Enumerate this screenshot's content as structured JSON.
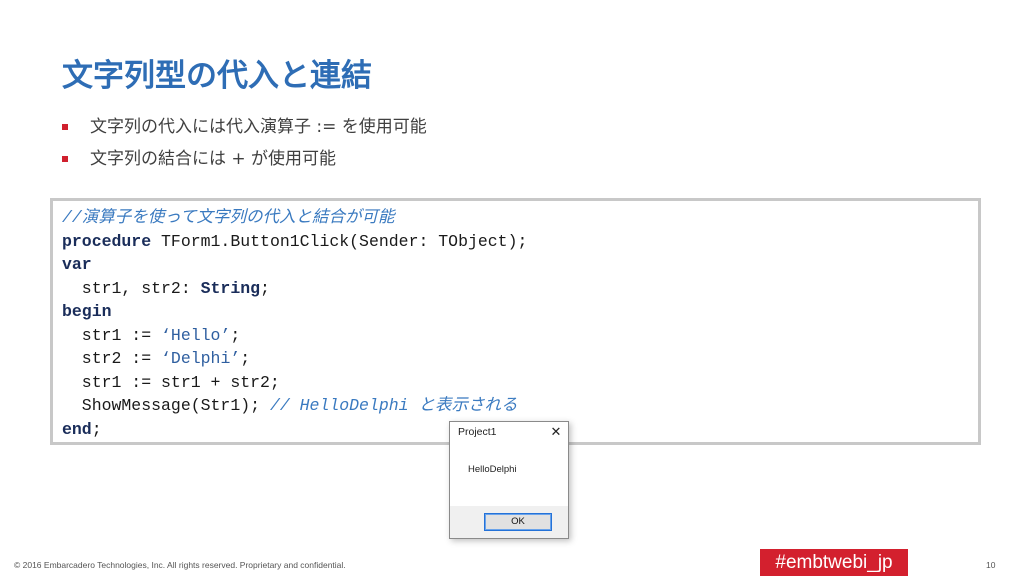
{
  "slide": {
    "title": "文字列型の代入と連結",
    "bullets": [
      "文字列の代入には代入演算子 := を使用可能",
      "文字列の結合には + が使用可能"
    ],
    "accent_color": "#2e6db5",
    "bullet_color": "#d0202e"
  },
  "code": {
    "lines": [
      [
        {
          "t": "//演算子を使って文字列の代入と結合が可能",
          "c": "cm"
        }
      ],
      [
        {
          "t": "procedure",
          "c": "kw"
        },
        {
          "t": " TForm1.Button1Click(Sender: TObject);",
          "c": ""
        }
      ],
      [
        {
          "t": "var",
          "c": "kw"
        }
      ],
      [
        {
          "t": "  str1, str2: ",
          "c": ""
        },
        {
          "t": "String",
          "c": "kw"
        },
        {
          "t": ";",
          "c": ""
        }
      ],
      [
        {
          "t": "begin",
          "c": "kw"
        }
      ],
      [
        {
          "t": "  str1 := ",
          "c": ""
        },
        {
          "t": "‘Hello’",
          "c": "str"
        },
        {
          "t": ";",
          "c": ""
        }
      ],
      [
        {
          "t": "  str2 := ",
          "c": ""
        },
        {
          "t": "‘Delphi’",
          "c": "str"
        },
        {
          "t": ";",
          "c": ""
        }
      ],
      [
        {
          "t": "  str1 := str1 + str2;",
          "c": ""
        }
      ],
      [
        {
          "t": "  ShowMessage(Str1); ",
          "c": ""
        },
        {
          "t": "// HelloDelphi と表示される",
          "c": "cm"
        }
      ],
      [
        {
          "t": "end",
          "c": "kw"
        },
        {
          "t": ";",
          "c": ""
        }
      ]
    ]
  },
  "dialog": {
    "title": "Project1",
    "close_glyph": "✕",
    "message": "HelloDelphi",
    "ok_label": "OK"
  },
  "footer": {
    "copyright": "© 2016 Embarcadero Technologies, Inc. All rights reserved. Proprietary and confidential.",
    "hashtag": "#embtwebi_jp",
    "page_number": "10",
    "hashtag_bg": "#d3202e"
  }
}
